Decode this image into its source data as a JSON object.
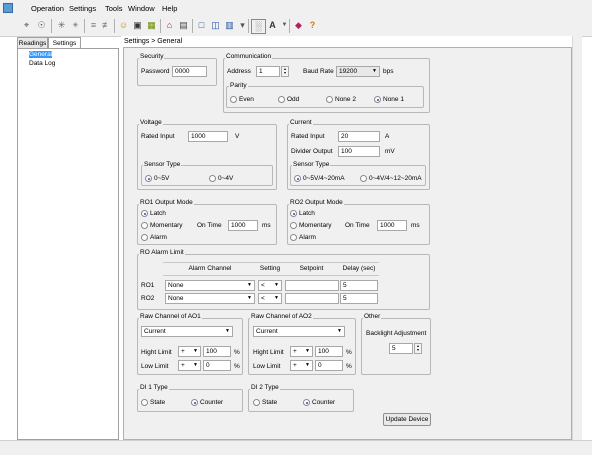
{
  "menu": [
    "Operation",
    "Settings",
    "Tools",
    "Window",
    "Help"
  ],
  "toolbar_icons": [
    "pin-icon",
    "bulb-icon",
    "asterisk-icon",
    "asterisk-off-icon",
    "tune-icon",
    "tune-off-icon",
    "smiley-icon",
    "stop-icon",
    "face-icon",
    "building-icon",
    "calendar-icon",
    "window-icon",
    "panel-icon",
    "layout-icon",
    "stack-icon",
    "chart-icon",
    "font-icon",
    "gem-icon",
    "help-icon"
  ],
  "tabs": {
    "readings": "Readings",
    "settings": "Settings"
  },
  "tree": {
    "general": "General",
    "datalog": "Data Log"
  },
  "breadcrumb": "Settings > General",
  "security": {
    "title": "Security",
    "password_label": "Password",
    "password": "0000"
  },
  "communication": {
    "title": "Communication",
    "address_label": "Address",
    "address": "1",
    "baud_label": "Baud Rate",
    "baud": "19200",
    "bps": "bps",
    "parity": {
      "title": "Parity",
      "even": "Even",
      "odd": "Odd",
      "none2": "None 2",
      "none1": "None 1"
    }
  },
  "voltage": {
    "title": "Voltage",
    "rated_label": "Rated Input",
    "rated": "1000",
    "unit": "V",
    "sensor": {
      "title": "Sensor Type",
      "a": "0~5V",
      "b": "0~4V"
    }
  },
  "current": {
    "title": "Current",
    "rated_label": "Rated Input",
    "rated": "20",
    "rated_unit": "A",
    "divider_label": "Divider Output",
    "divider": "100",
    "divider_unit": "mV",
    "sensor": {
      "title": "Sensor Type",
      "a": "0~5V/4~20mA",
      "b": "0~4V/4~12~20mA"
    }
  },
  "ro1": {
    "title": "RO1 Output Mode",
    "latch": "Latch",
    "momentary": "Momentary",
    "alarm": "Alarm",
    "ontime_label": "On Time",
    "ontime": "1000",
    "ms": "ms"
  },
  "ro2": {
    "title": "RO2 Output Mode",
    "latch": "Latch",
    "momentary": "Momentary",
    "alarm": "Alarm",
    "ontime_label": "On Time",
    "ontime": "1000",
    "ms": "ms"
  },
  "alarm": {
    "title": "RO Alarm Limit",
    "col_channel": "Alarm Channel",
    "col_setting": "Setting",
    "col_setpoint": "Setpoint",
    "col_delay": "Delay (sec)",
    "rows": [
      {
        "label": "RO1",
        "channel": "None",
        "setting": "<",
        "setpoint": "",
        "delay": "5"
      },
      {
        "label": "RO2",
        "channel": "None",
        "setting": "<",
        "setpoint": "",
        "delay": "5"
      }
    ]
  },
  "ao1": {
    "title": "Raw Channel of AO1",
    "channel": "Current",
    "high_label": "Hight Limit",
    "high_op": "+",
    "high": "100",
    "low_label": "Low Limit",
    "low_op": "+",
    "low": "0",
    "pct": "%"
  },
  "ao2": {
    "title": "Raw Channel of AO2",
    "channel": "Current",
    "high_label": "Hight Limit",
    "high_op": "+",
    "high": "100",
    "low_label": "Low Limit",
    "low_op": "+",
    "low": "0",
    "pct": "%"
  },
  "other": {
    "title": "Other",
    "backlight_label": "Backlight Adjustment",
    "backlight": "5"
  },
  "di1": {
    "title": "DI 1 Type",
    "state": "State",
    "counter": "Counter"
  },
  "di2": {
    "title": "DI 2 Type",
    "state": "State",
    "counter": "Counter"
  },
  "update_button": "Update Device"
}
